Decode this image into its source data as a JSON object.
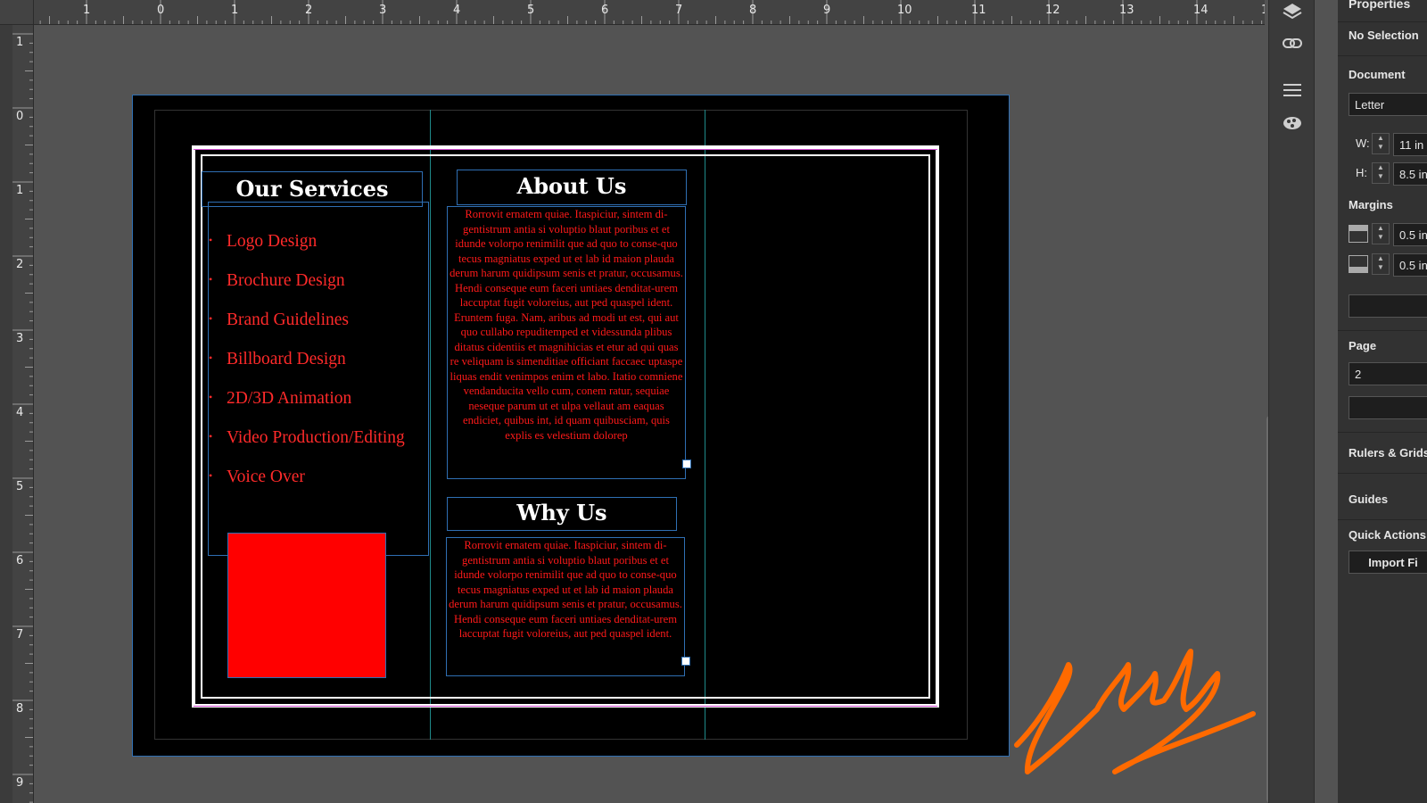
{
  "rulers": {
    "top": [
      "1",
      "0",
      "1",
      "2",
      "3",
      "4",
      "5",
      "6",
      "7",
      "8",
      "9",
      "10",
      "11",
      "12",
      "13",
      "14",
      "1"
    ],
    "left": [
      "1",
      "0",
      "1",
      "2",
      "3",
      "4",
      "5",
      "6",
      "7",
      "8",
      "9"
    ]
  },
  "document": {
    "services": {
      "title": "Our Services",
      "items": [
        "Logo Design",
        "Brochure Design",
        "Brand Guidelines",
        "Billboard Design",
        "2D/3D Animation",
        "Video Production/Editing",
        "Voice Over"
      ]
    },
    "about": {
      "title": "About Us",
      "paragraphs": [
        "Rorrovit ernatem quiae. Itaspiciur, sintem di-gentistrum antia si voluptio blaut poribus et et idunde volorpo renimilit que ad quo to conse-quo tecus magniatus exped ut et lab id maion plauda derum harum quidipsum senis et pratur, occusamus.",
        "Hendi conseque eum faceri untiaes denditat-urem laccuptat fugit voloreius, aut ped quaspel ident.",
        "Eruntem fuga. Nam, aribus ad modi ut est, qui aut quo cullabo repuditemped et videssunda plibus ditatus cidentiis et magnihicias et etur ad qui quas re veliquam is simenditiae officiant faccaec uptaspe liquas endit venimpos enim et labo. Itatio comniene vendanducita vello cum, conem ratur, sequiae neseque parum ut et ulpa vellaut am eaquas endiciet, quibus int, id quam quibusciam, quis explis es velestium dolorep"
      ]
    },
    "why": {
      "title": "Why Us",
      "paragraphs": [
        "Rorrovit ernatem quiae. Itaspiciur, sintem di-gentistrum antia si voluptio blaut poribus et et idunde volorpo renimilit que ad quo to conse-quo tecus magniatus exped ut et lab id maion plauda derum harum quidipsum senis et pratur, occusamus.",
        "Hendi conseque eum faceri untiaes denditat-urem laccuptat fugit voloreius, aut ped quaspel ident."
      ]
    },
    "colors": {
      "accent": "#ff0000",
      "guide": "#1f8a8a",
      "frame": "#2f6fb3"
    }
  },
  "panel": {
    "title": "Properties",
    "selection": "No Selection",
    "document_label": "Document",
    "size_preset": "Letter",
    "w_label": "W:",
    "w_value": "11 in",
    "h_label": "H:",
    "h_value": "8.5 in",
    "margins_label": "Margins",
    "margin_top": "0.5 in",
    "margin_bottom": "0.5 in",
    "page_label": "Page",
    "page_value": "2",
    "rulers_grids": "Rulers & Grids",
    "guides": "Guides",
    "quick_actions": "Quick Actions",
    "import_button": "Import Fi"
  },
  "panel_icons": [
    "layers-icon",
    "links-icon",
    "stroke-icon",
    "swatches-icon"
  ]
}
